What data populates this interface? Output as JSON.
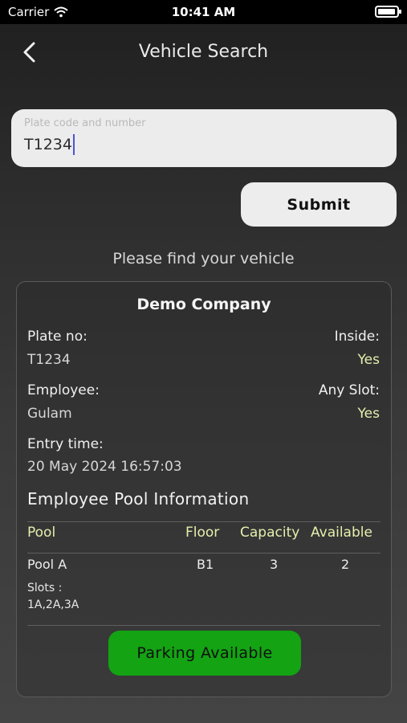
{
  "status_bar": {
    "carrier": "Carrier",
    "time": "10:41 AM",
    "battery_level": 0.95
  },
  "header": {
    "title": "Vehicle Search"
  },
  "search": {
    "placeholder": "Plate code and number",
    "value": "T1234"
  },
  "submit_label": "Submit",
  "find_text": "Please find your vehicle",
  "result": {
    "company": "Demo Company",
    "plate_label": "Plate no:",
    "plate_value": "T1234",
    "inside_label": "Inside:",
    "inside_value": "Yes",
    "employee_label": "Employee:",
    "employee_value": "Gulam",
    "any_slot_label": "Any Slot:",
    "any_slot_value": "Yes",
    "entry_label": "Entry time:",
    "entry_value": "20 May 2024 16:57:03",
    "pool_heading": "Employee Pool Information",
    "columns": [
      "Pool",
      "Floor",
      "Capacity",
      "Available"
    ],
    "rows": [
      {
        "pool": "Pool A",
        "floor": "B1",
        "capacity": "3",
        "available": "2",
        "slots_label": "Slots :",
        "slots": "1A,2A,3A"
      }
    ],
    "status_button": "Parking Available"
  },
  "colors": {
    "accent": "#e6efad",
    "status_green": "#13a313",
    "caret": "#4a54d8"
  }
}
